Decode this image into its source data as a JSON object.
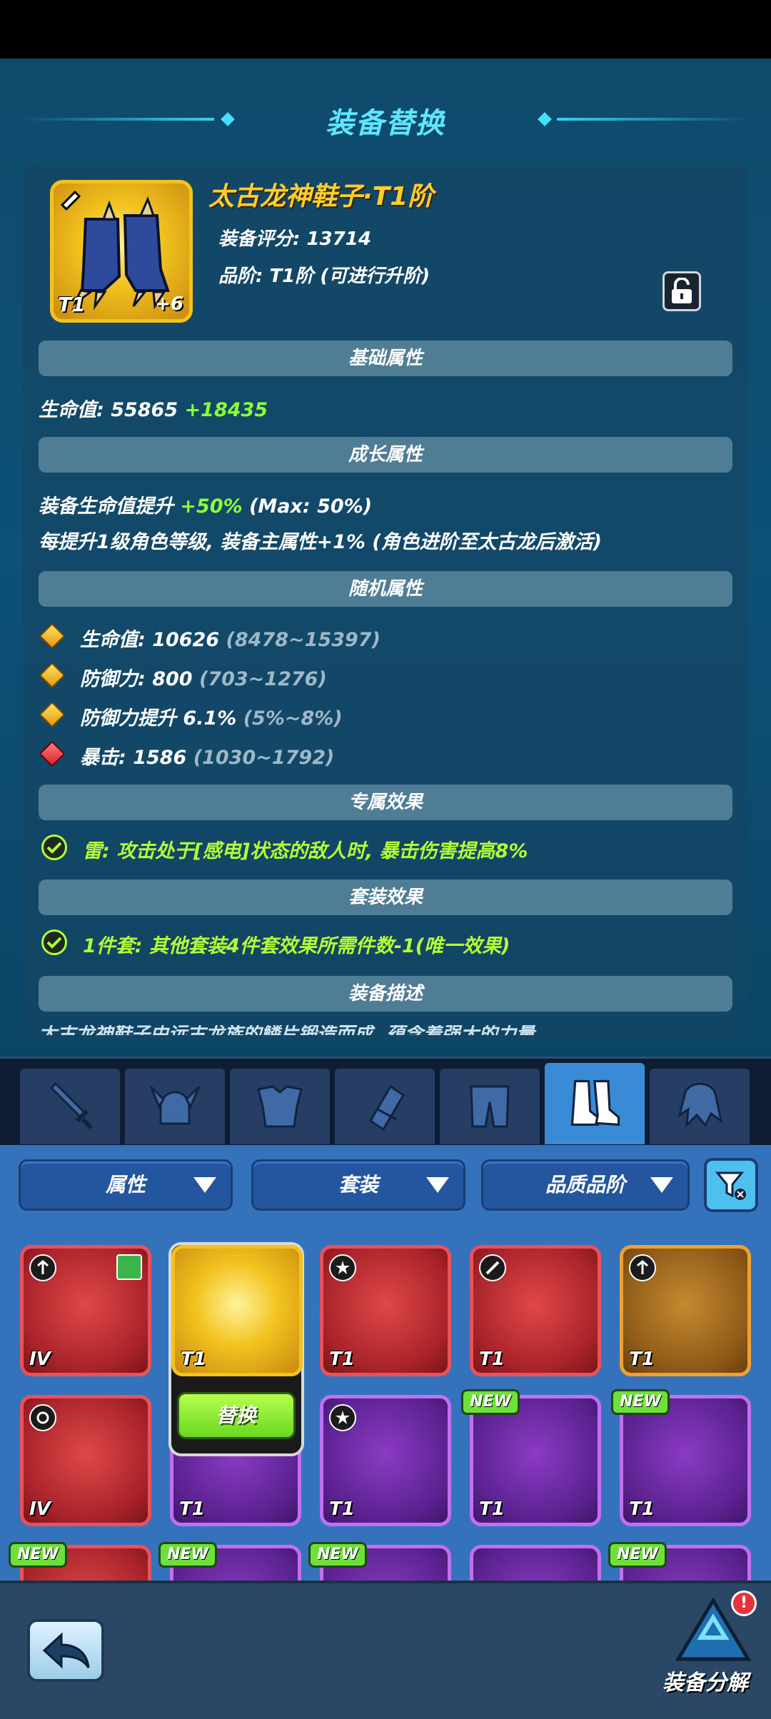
{
  "header": {
    "title": "装备替换"
  },
  "item": {
    "name": "太古龙神鞋子·T1阶",
    "score": "装备评分: 13714",
    "tier": "品阶: T1阶 (可进行升阶)",
    "tier_badge": "T1",
    "plus_level": "+6"
  },
  "sections": {
    "base": "基础属性",
    "growth": "成长属性",
    "random": "随机属性",
    "exclusive": "专属效果",
    "set": "套装效果",
    "desc": "装备描述"
  },
  "base_attr": {
    "label": "生命值: 55865",
    "bonus": "+18435"
  },
  "growth_attr": {
    "line1_label": "装备生命值提升",
    "line1_value": "+50%",
    "line1_max": "(Max: 50%)",
    "line2": "每提升1级角色等级, 装备主属性+1% (角色进阶至太古龙后激活)"
  },
  "random_attrs": [
    {
      "label": "生命值: 10626",
      "range": "(8478~15397)",
      "gem": "gold"
    },
    {
      "label": "防御力: 800",
      "range": "(703~1276)",
      "gem": "gold"
    },
    {
      "label": "防御力提升 6.1%",
      "range": "(5%~8%)",
      "gem": "gold"
    },
    {
      "label": "暴击: 1586",
      "range": "(1030~1792)",
      "gem": "red"
    }
  ],
  "exclusive_effect": "雷: 攻击处于[感电]状态的敌人时, 暴击伤害提高8%",
  "set_effect": "1件套: 其他套装4件套效果所需件数-1(唯一效果)",
  "description_partial": "太古龙神鞋子由远古龙族的鳞片锻造而成, 蕴含着强大的力量",
  "tabs": [
    {
      "name": "weapon",
      "icon": "sword-icon"
    },
    {
      "name": "helmet",
      "icon": "horned-helmet-icon"
    },
    {
      "name": "armor",
      "icon": "chest-armor-icon"
    },
    {
      "name": "bracer",
      "icon": "bracer-icon"
    },
    {
      "name": "pants",
      "icon": "pants-icon"
    },
    {
      "name": "boots",
      "icon": "boots-icon",
      "active": true
    },
    {
      "name": "cape",
      "icon": "cape-icon"
    }
  ],
  "filters": {
    "attr": "属性",
    "set": "套装",
    "quality": "品质品阶"
  },
  "inventory": {
    "row1": [
      {
        "color": "red",
        "tier": "IV"
      },
      {
        "color": "gold",
        "tier": "T1",
        "selected": true
      },
      {
        "color": "red",
        "tier": "T1"
      },
      {
        "color": "red",
        "tier": "T1"
      },
      {
        "color": "orange",
        "tier": "T1"
      }
    ],
    "row2": [
      {
        "color": "red",
        "tier": "IV"
      },
      {
        "color": "purple",
        "tier": "T1"
      },
      {
        "color": "purple",
        "tier": "T1"
      },
      {
        "color": "purple",
        "tier": "T1",
        "new": true
      },
      {
        "color": "purple",
        "tier": "T1",
        "new": true
      }
    ],
    "new_label": "NEW"
  },
  "replace_button": "替换",
  "bottom": {
    "decompose": "装备分解",
    "alert": "!"
  },
  "colors": {
    "title": "#5fe6ff",
    "name": "#ffce2a",
    "green": "#8cff3a"
  }
}
